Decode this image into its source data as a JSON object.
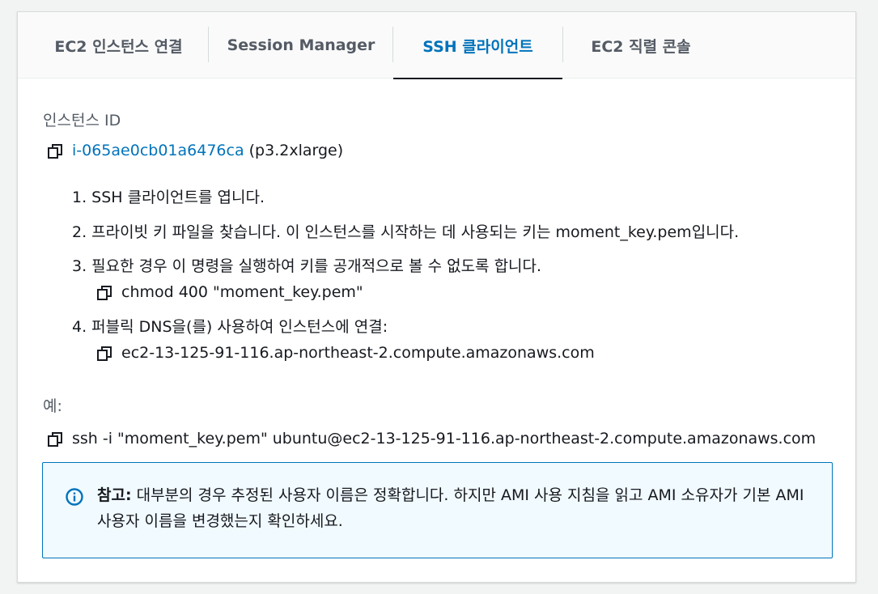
{
  "tabs": [
    {
      "label": "EC2 인스턴스 연결"
    },
    {
      "label": "Session Manager"
    },
    {
      "label": "SSH 클라이언트",
      "active": true
    },
    {
      "label": "EC2 직렬 콘솔"
    }
  ],
  "instance": {
    "label": "인스턴스 ID",
    "id": "i-065ae0cb01a6476ca",
    "type": "(p3.2xlarge)"
  },
  "steps": [
    {
      "text": "1. SSH 클라이언트를 엽니다."
    },
    {
      "text": "2. 프라이빗 키 파일을 찾습니다. 이 인스턴스를 시작하는 데 사용되는 키는 moment_key.pem입니다."
    },
    {
      "text": "3. 필요한 경우 이 명령을 실행하여 키를 공개적으로 볼 수 없도록 합니다.",
      "command": "chmod 400 \"moment_key.pem\""
    },
    {
      "text": "4. 퍼블릭 DNS을(를) 사용하여 인스턴스에 연결:",
      "command": "ec2-13-125-91-116.ap-northeast-2.compute.amazonaws.com"
    }
  ],
  "example": {
    "label": "예:",
    "command": "ssh -i \"moment_key.pem\" ubuntu@ec2-13-125-91-116.ap-northeast-2.compute.amazonaws.com"
  },
  "notice": {
    "title": "참고:",
    "text": " 대부분의 경우 추정된 사용자 이름은 정확합니다. 하지만 AMI 사용 지침을 읽고 AMI 소유자가 기본 AMI 사용자 이름을 변경했는지 확인하세요."
  },
  "colors": {
    "accent": "#0073bb",
    "notice_bg": "#f1faff",
    "text": "#16191f",
    "muted": "#545b64"
  },
  "icons": {
    "copy": "copy-icon",
    "info": "info-icon"
  }
}
